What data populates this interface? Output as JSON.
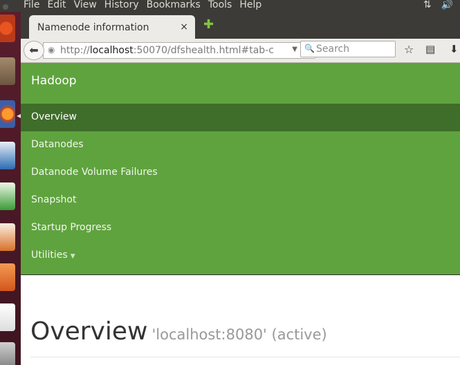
{
  "menubar": {
    "items": [
      "File",
      "Edit",
      "View",
      "History",
      "Bookmarks",
      "Tools",
      "Help"
    ],
    "tray_icons": [
      "network-icon",
      "volume-icon"
    ]
  },
  "launcher": {
    "icons": [
      "ubuntu-dash-icon",
      "files-icon",
      "firefox-icon",
      "writer-icon",
      "calc-icon",
      "impress-icon",
      "software-center-icon",
      "amazon-icon",
      "settings-icon"
    ],
    "colors": {
      "bg": "#5a1e2e"
    }
  },
  "browser": {
    "tab_title": "Namenode information",
    "tab_close": "×",
    "new_tab": "✚",
    "url": {
      "scheme": "http://",
      "host": "localhost",
      "rest": ":50070/dfshealth.html#tab-c"
    },
    "search_placeholder": "Search"
  },
  "page": {
    "brand": "Hadoop",
    "nav_items": [
      {
        "label": "Overview",
        "active": true
      },
      {
        "label": "Datanodes"
      },
      {
        "label": "Datanode Volume Failures"
      },
      {
        "label": "Snapshot"
      },
      {
        "label": "Startup Progress"
      },
      {
        "label": "Utilities",
        "caret": "▼"
      }
    ],
    "heading": "Overview",
    "subheading": "'localhost:8080' (active)",
    "colors": {
      "nav_bg": "#5fa33e",
      "nav_active": "#3f6d2a"
    }
  }
}
